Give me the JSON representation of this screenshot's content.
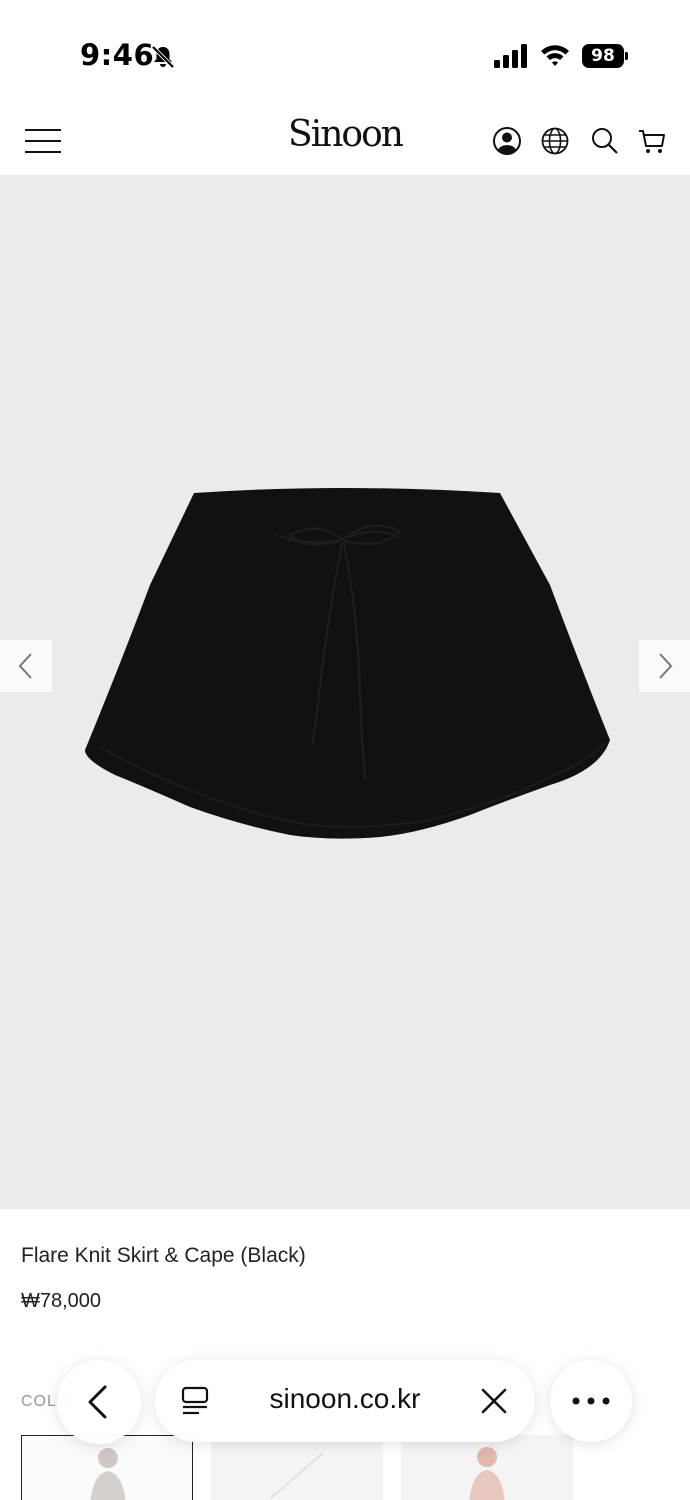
{
  "status_bar": {
    "time": "9:46",
    "battery": "98"
  },
  "header": {
    "logo": "Sinoon",
    "icons": [
      "menu-icon",
      "account-icon",
      "globe-icon",
      "search-icon",
      "cart-icon"
    ]
  },
  "product": {
    "name": "Flare Knit Skirt & Cape (Black)",
    "price": "₩78,000",
    "color_label": "COLO"
  },
  "browser": {
    "url": "sinoon.co.kr"
  },
  "colors": {
    "gallery_bg": "#ebebeb",
    "text": "#222222",
    "product": "#111111"
  }
}
